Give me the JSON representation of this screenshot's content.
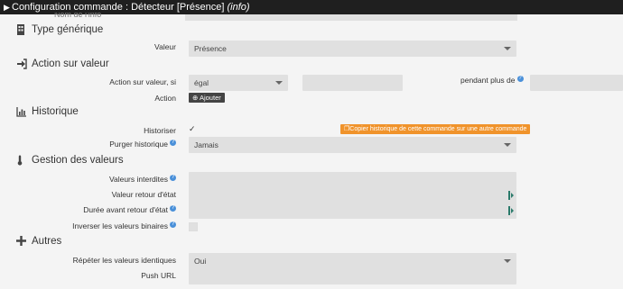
{
  "window": {
    "title_prefix": "Configuration commande : Détecteur [Présence]",
    "title_suffix": "(info)"
  },
  "top_partial": {
    "label": "Nom de l'info"
  },
  "type_generique": {
    "heading": "Type générique",
    "label": "Valeur",
    "value": "Présence"
  },
  "action_sur_valeur": {
    "heading": "Action sur valeur",
    "condition_label": "Action sur valeur, si",
    "operator": "égal",
    "duration_label": "pendant plus de",
    "action_label": "Action",
    "add_button": "Ajouter"
  },
  "historique": {
    "heading": "Historique",
    "historiser_label": "Historiser",
    "copy_button": "Copier historique de cette commande sur une autre commande",
    "purger_label": "Purger historique",
    "purger_value": "Jamais"
  },
  "gestion": {
    "heading": "Gestion des valeurs",
    "interdites_label": "Valeurs interdites",
    "retour_label": "Valeur retour d'état",
    "duree_label": "Durée avant retour d'état",
    "inverser_label": "Inverser les valeurs binaires"
  },
  "autres": {
    "heading": "Autres",
    "repeter_label": "Répéter les valeurs identiques",
    "repeter_value": "Oui",
    "push_label": "Push URL"
  },
  "icons": {
    "help": "?",
    "check": "✓"
  },
  "colors": {
    "accent_orange": "#f0932b",
    "help_blue": "#4a90d9",
    "titlebar": "#1f1f1f"
  }
}
